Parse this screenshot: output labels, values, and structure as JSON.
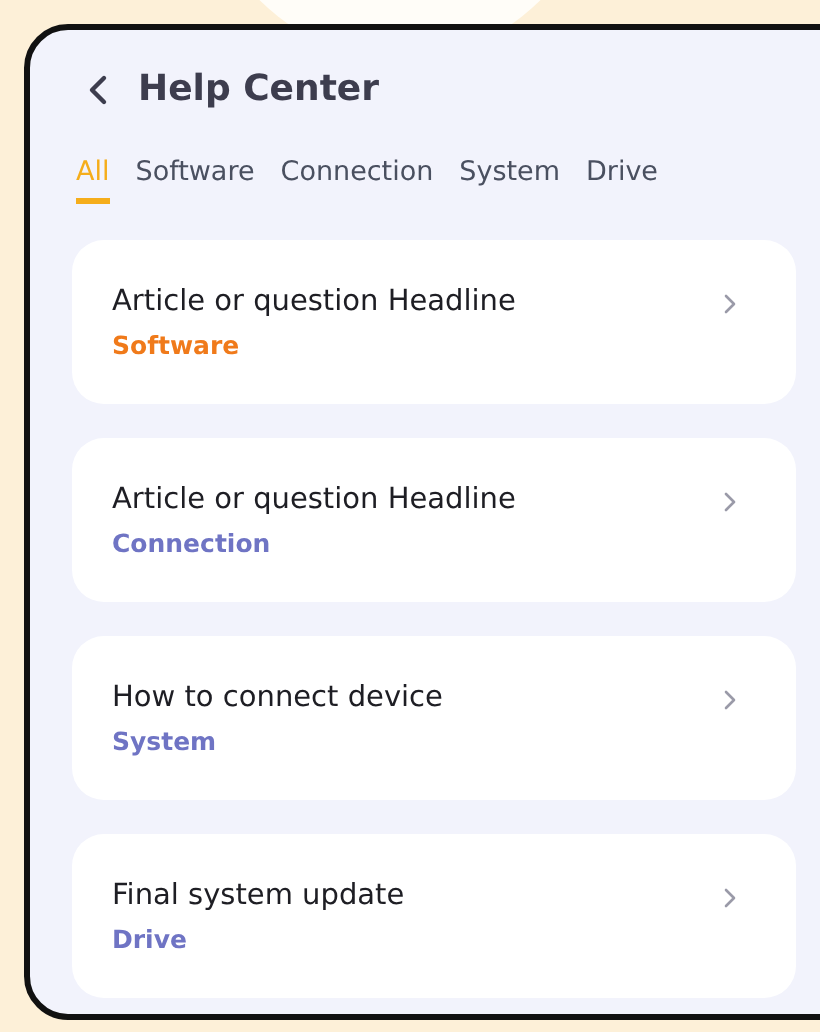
{
  "header": {
    "title": "Help Center"
  },
  "tabs": [
    {
      "label": "All",
      "selected": true
    },
    {
      "label": "Software",
      "selected": false
    },
    {
      "label": "Connection",
      "selected": false
    },
    {
      "label": "System",
      "selected": false
    },
    {
      "label": "Drive",
      "selected": false
    }
  ],
  "articles": [
    {
      "title": "Article or question Headline",
      "category": "Software",
      "color": "#f07a1a"
    },
    {
      "title": "Article or question Headline",
      "category": "Connection",
      "color": "#6f74c4"
    },
    {
      "title": "How to connect device",
      "category": "System",
      "color": "#6f74c4"
    },
    {
      "title": "Final system update",
      "category": "Drive",
      "color": "#6f74c4"
    }
  ]
}
